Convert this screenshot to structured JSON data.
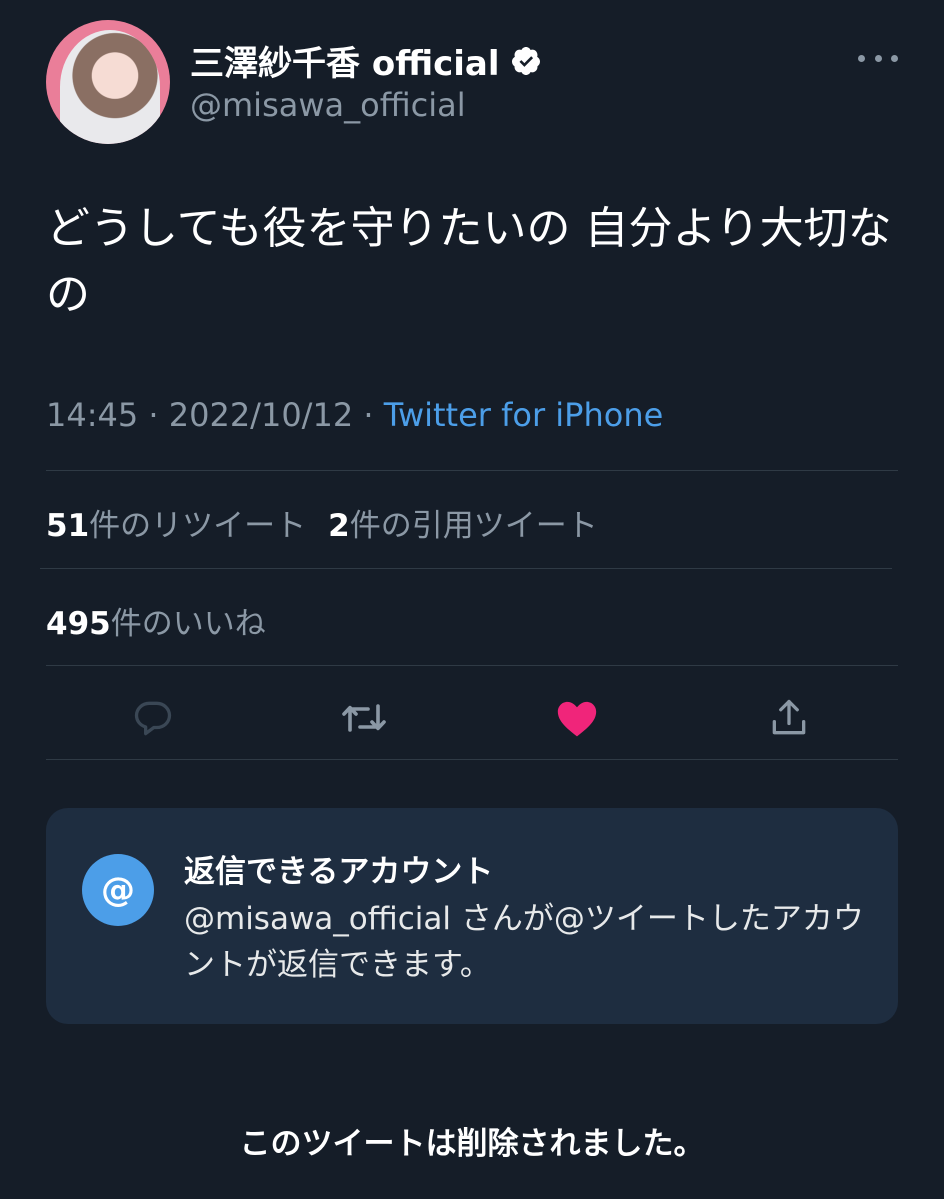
{
  "author": {
    "display_name": "三澤紗千香 official",
    "handle": "@misawa_official",
    "avatar_icon": "profile-photo",
    "verified_icon": "verified-badge-icon"
  },
  "tweet": {
    "text": "どうしても役を守りたいの 自分より大切なの",
    "meta_time_date": "14:45 · 2022/10/12 · ",
    "meta_source": "Twitter for iPhone"
  },
  "stats": {
    "retweets_count": "51",
    "retweets_label": "件のリツイート",
    "quotes_count": "2",
    "quotes_label": "件の引用ツイート",
    "likes_count": "495",
    "likes_label": "件のいいね"
  },
  "actions": {
    "reply_icon": "reply-icon",
    "retweet_icon": "retweet-icon",
    "like_icon": "heart-icon",
    "like_active": true,
    "share_icon": "share-icon"
  },
  "reply_restriction": {
    "badge": "@",
    "title": "返信できるアカウント",
    "body": "@misawa_official さんが@ツイートしたアカウントが返信できます。"
  },
  "notice": "このツイートは削除されました。",
  "colors": {
    "background": "#151d28",
    "accent": "#4c9ee8",
    "like": "#f0257a",
    "muted": "#8b98a5",
    "card": "#1e2d40"
  }
}
